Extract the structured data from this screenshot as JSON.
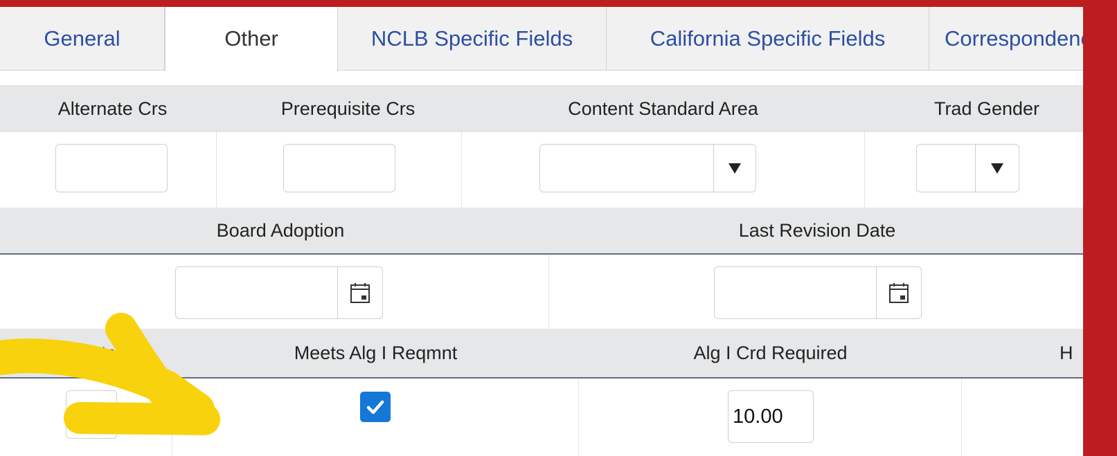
{
  "tabs": [
    {
      "label": "General"
    },
    {
      "label": "Other"
    },
    {
      "label": "NCLB Specific Fields"
    },
    {
      "label": "California Specific Fields"
    },
    {
      "label": "Correspondence"
    }
  ],
  "section1": {
    "headers": {
      "alternate_crs": "Alternate Crs",
      "prerequisite_crs": "Prerequisite Crs",
      "content_standard_area": "Content Standard Area",
      "trad_gender": "Trad Gender"
    },
    "values": {
      "alternate_crs": "",
      "prerequisite_crs": "",
      "content_standard_area": "",
      "trad_gender": ""
    }
  },
  "section2": {
    "headers": {
      "board_adoption": "Board Adoption",
      "last_revision_date": "Last Revision Date"
    },
    "values": {
      "board_adoption": "",
      "last_revision_date": ""
    }
  },
  "section3": {
    "headers": {
      "seats": "Seats",
      "meets_alg_reqmnt": "Meets Alg I Reqmnt",
      "alg_crd_required": "Alg I Crd Required",
      "partial": "H"
    },
    "values": {
      "seats": "",
      "meets_alg_reqmnt_checked": true,
      "alg_crd_required": "10.00"
    }
  },
  "colors": {
    "background": "#bd1d1f",
    "tab_text": "#2c4fa3",
    "checkbox": "#1577d6",
    "arrow": "#f8d20c"
  },
  "icons": {
    "dropdown": "caret-down-icon",
    "calendar": "calendar-icon",
    "check": "checkmark-icon",
    "annotation": "arrow-icon"
  }
}
